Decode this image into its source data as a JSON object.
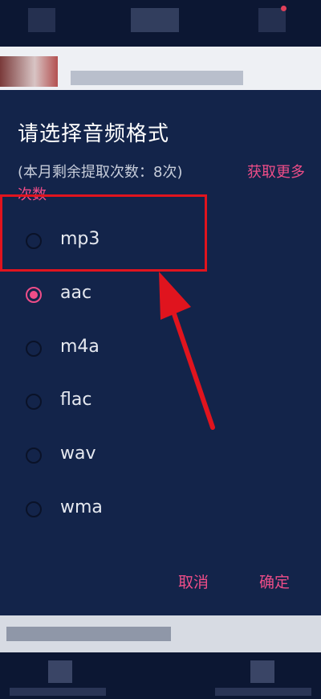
{
  "dialog": {
    "title": "请选择音频格式",
    "quota_text": "(本月剩余提取次数：8次)",
    "get_more_line1": "获取更多",
    "get_more_line2": "次数",
    "options": [
      {
        "label": "mp3",
        "checked": false
      },
      {
        "label": "aac",
        "checked": true
      },
      {
        "label": "m4a",
        "checked": false
      },
      {
        "label": "flac",
        "checked": false
      },
      {
        "label": "wav",
        "checked": false
      },
      {
        "label": "wma",
        "checked": false
      }
    ],
    "cancel_label": "取消",
    "confirm_label": "确定"
  },
  "colors": {
    "dialog_bg": "#13244a",
    "accent": "#ee4d88",
    "annotation_red": "#e0141e"
  }
}
